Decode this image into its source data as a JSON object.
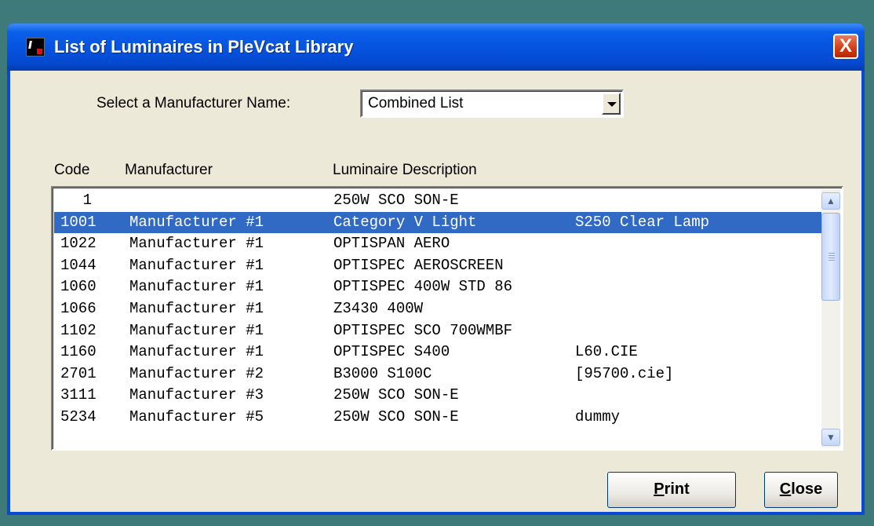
{
  "window": {
    "title": "List of Luminaires in PleVcat Library",
    "close_glyph": "X"
  },
  "manufacturer_select": {
    "label": "Select a Manufacturer Name:",
    "value": "Combined List"
  },
  "columns": {
    "code": "Code",
    "manufacturer": "Manufacturer",
    "description": "Luminaire Description"
  },
  "rows": [
    {
      "code": "1",
      "manufacturer": "",
      "description": "250W SCO SON-E",
      "extra": ""
    },
    {
      "code": "1001",
      "manufacturer": "Manufacturer #1",
      "description": "Category V Light",
      "extra": "S250 Clear Lamp"
    },
    {
      "code": "1022",
      "manufacturer": "Manufacturer #1",
      "description": "OPTISPAN AERO",
      "extra": ""
    },
    {
      "code": "1044",
      "manufacturer": "Manufacturer #1",
      "description": "OPTISPEC AEROSCREEN",
      "extra": ""
    },
    {
      "code": "1060",
      "manufacturer": "Manufacturer #1",
      "description": "OPTISPEC 400W STD 86",
      "extra": ""
    },
    {
      "code": "1066",
      "manufacturer": "Manufacturer #1",
      "description": "Z3430 400W",
      "extra": ""
    },
    {
      "code": "1102",
      "manufacturer": "Manufacturer #1",
      "description": "OPTISPEC SCO 700WMBF",
      "extra": ""
    },
    {
      "code": "1160",
      "manufacturer": "Manufacturer #1",
      "description": "OPTISPEC S400",
      "extra": "L60.CIE"
    },
    {
      "code": "2701",
      "manufacturer": "Manufacturer #2",
      "description": "B3000 S100C",
      "extra": "[95700.cie]"
    },
    {
      "code": "3111",
      "manufacturer": "Manufacturer #3",
      "description": "250W SCO SON-E",
      "extra": ""
    },
    {
      "code": "5234",
      "manufacturer": "Manufacturer #5",
      "description": "250W SCO SON-E",
      "extra": "dummy"
    }
  ],
  "buttons": {
    "print": {
      "mnemonic": "P",
      "rest": "rint"
    },
    "close": {
      "mnemonic": "C",
      "rest": "lose"
    }
  },
  "icons": {
    "scroll_up": "▲",
    "scroll_down": "▼"
  },
  "colors": {
    "selection": "#316ac5",
    "titlebar": "#0654e0",
    "face": "#ece9d8"
  }
}
